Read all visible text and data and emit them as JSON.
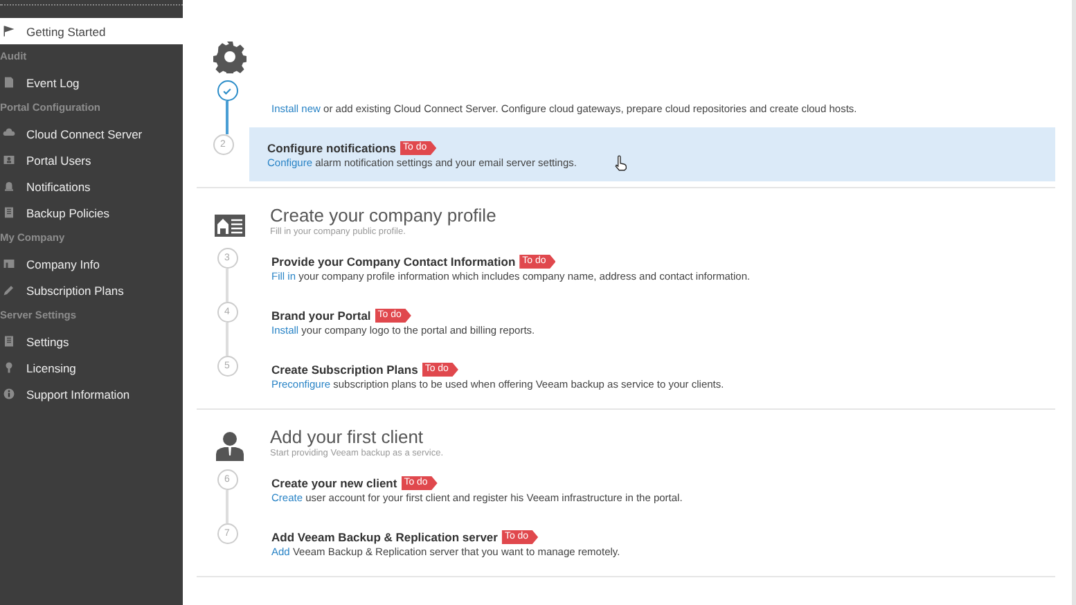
{
  "sidebar": {
    "items": [
      {
        "kind": "item",
        "label": "Getting Started",
        "selected": true
      },
      {
        "kind": "header",
        "label": "Audit"
      },
      {
        "kind": "item",
        "label": "Event Log",
        "selected": false
      },
      {
        "kind": "header",
        "label": "Portal Configuration"
      },
      {
        "kind": "item",
        "label": "Cloud Connect Server",
        "selected": false
      },
      {
        "kind": "item",
        "label": "Portal Users",
        "selected": false
      },
      {
        "kind": "item",
        "label": "Notifications",
        "selected": false
      },
      {
        "kind": "item",
        "label": "Backup Policies",
        "selected": false
      },
      {
        "kind": "header",
        "label": "My Company"
      },
      {
        "kind": "item",
        "label": "Company Info",
        "selected": false
      },
      {
        "kind": "item",
        "label": "Subscription Plans",
        "selected": false
      },
      {
        "kind": "header",
        "label": "Server Settings"
      },
      {
        "kind": "item",
        "label": "Settings",
        "selected": false
      },
      {
        "kind": "item",
        "label": "Licensing",
        "selected": false
      },
      {
        "kind": "item",
        "label": "Support Information",
        "selected": false
      }
    ]
  },
  "sections": [
    {
      "steps": [
        {
          "done": true,
          "highlighted": false,
          "link": "Install new",
          "text": " or add existing Cloud Connect Server. Configure cloud gateways, prepare cloud repositories and create cloud hosts."
        },
        {
          "number": "2",
          "done": false,
          "highlighted": true,
          "title": "Configure notifications",
          "badge": "To do",
          "link": "Configure",
          "text": " alarm notification settings and your email server settings."
        }
      ]
    },
    {
      "title": "Create your company profile",
      "subtitle": "Fill in your company public profile.",
      "steps": [
        {
          "number": "3",
          "done": false,
          "highlighted": false,
          "title": "Provide your Company Contact Information",
          "badge": "To do",
          "link": "Fill in",
          "text": " your company profile information which includes company name, address and contact information."
        },
        {
          "number": "4",
          "done": false,
          "highlighted": false,
          "title": "Brand your Portal",
          "badge": "To do",
          "link": "Install",
          "text": " your company logo to the portal and billing reports."
        },
        {
          "number": "5",
          "done": false,
          "highlighted": false,
          "title": "Create Subscription Plans",
          "badge": "To do",
          "link": "Preconfigure",
          "text": " subscription plans to be used when offering Veeam backup as service to your clients."
        }
      ]
    },
    {
      "title": "Add your first client",
      "subtitle": "Start providing Veeam backup as a service.",
      "steps": [
        {
          "number": "6",
          "done": false,
          "highlighted": false,
          "title": "Create your new client",
          "badge": "To do",
          "link": "Create",
          "text": " user account for your first client and register his Veeam infrastructure in the portal."
        },
        {
          "number": "7",
          "done": false,
          "highlighted": false,
          "title": "Add Veeam Backup & Replication server",
          "badge": "To do",
          "link": "Add",
          "text": " Veeam Backup & Replication server that you want to manage remotely."
        }
      ]
    }
  ]
}
